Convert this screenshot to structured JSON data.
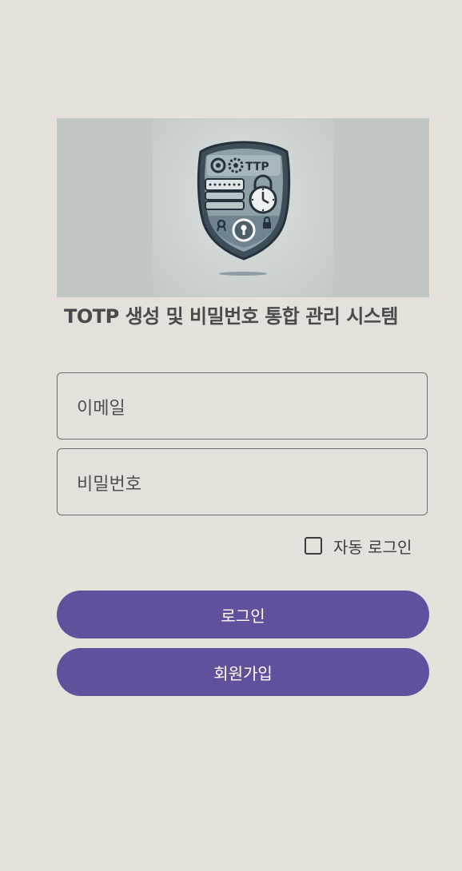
{
  "hero": {
    "image_name": "totp-shield-illustration",
    "shield_text": "TTP"
  },
  "title": "TOTP 생성 및 비밀번호 통합 관리 시스템",
  "form": {
    "email_placeholder": "이메일",
    "password_placeholder": "비밀번호",
    "auto_login_label": "자동 로그인",
    "auto_login_checked": false
  },
  "buttons": {
    "login_label": "로그인",
    "signup_label": "회원가입"
  },
  "colors": {
    "background": "#e5e1da",
    "primary_button": "#63509d",
    "field_border": "#6f6c70",
    "title_text": "#4a4a4d"
  }
}
